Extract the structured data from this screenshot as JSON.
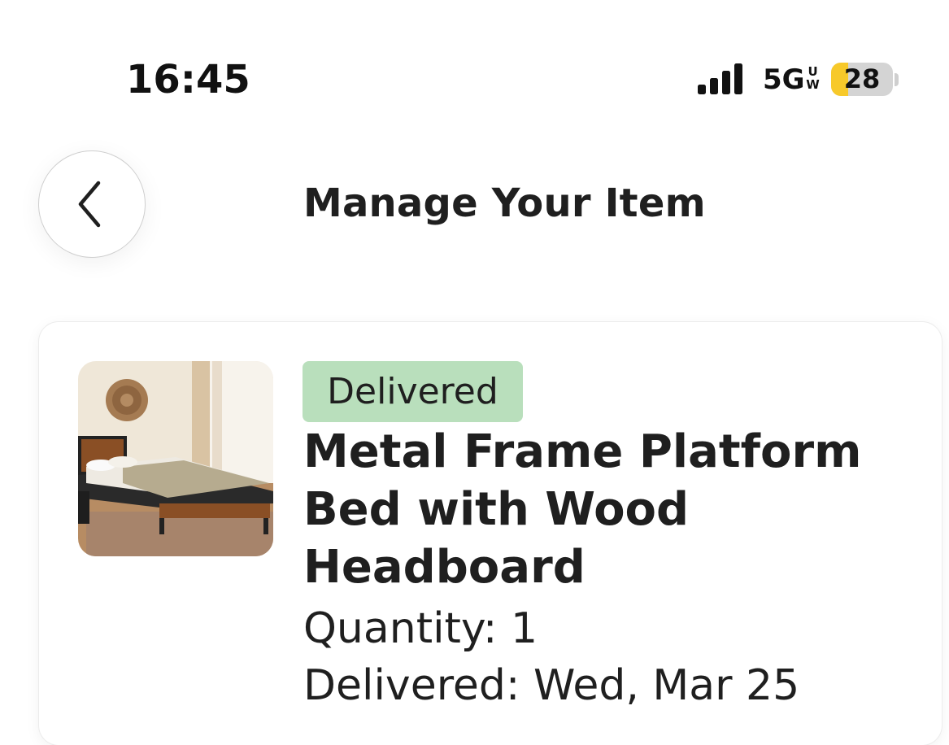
{
  "status_bar": {
    "time": "16:45",
    "network": "5G",
    "network_suffix_top": "U",
    "network_suffix_bottom": "W",
    "battery_level": "28",
    "battery_fraction": 0.28,
    "battery_color": "#f7c92a",
    "signal_bars": 4
  },
  "header": {
    "back_icon": "chevron-left-icon",
    "title": "Manage Your Item"
  },
  "item": {
    "image_icon": "bed-photo",
    "status": "Delivered",
    "status_color": "#b9dfbc",
    "name": "Metal Frame Platform Bed with Wood Headboard",
    "quantity_label": "Quantity: 1",
    "delivered_label": "Delivered: Wed, Mar 25"
  }
}
